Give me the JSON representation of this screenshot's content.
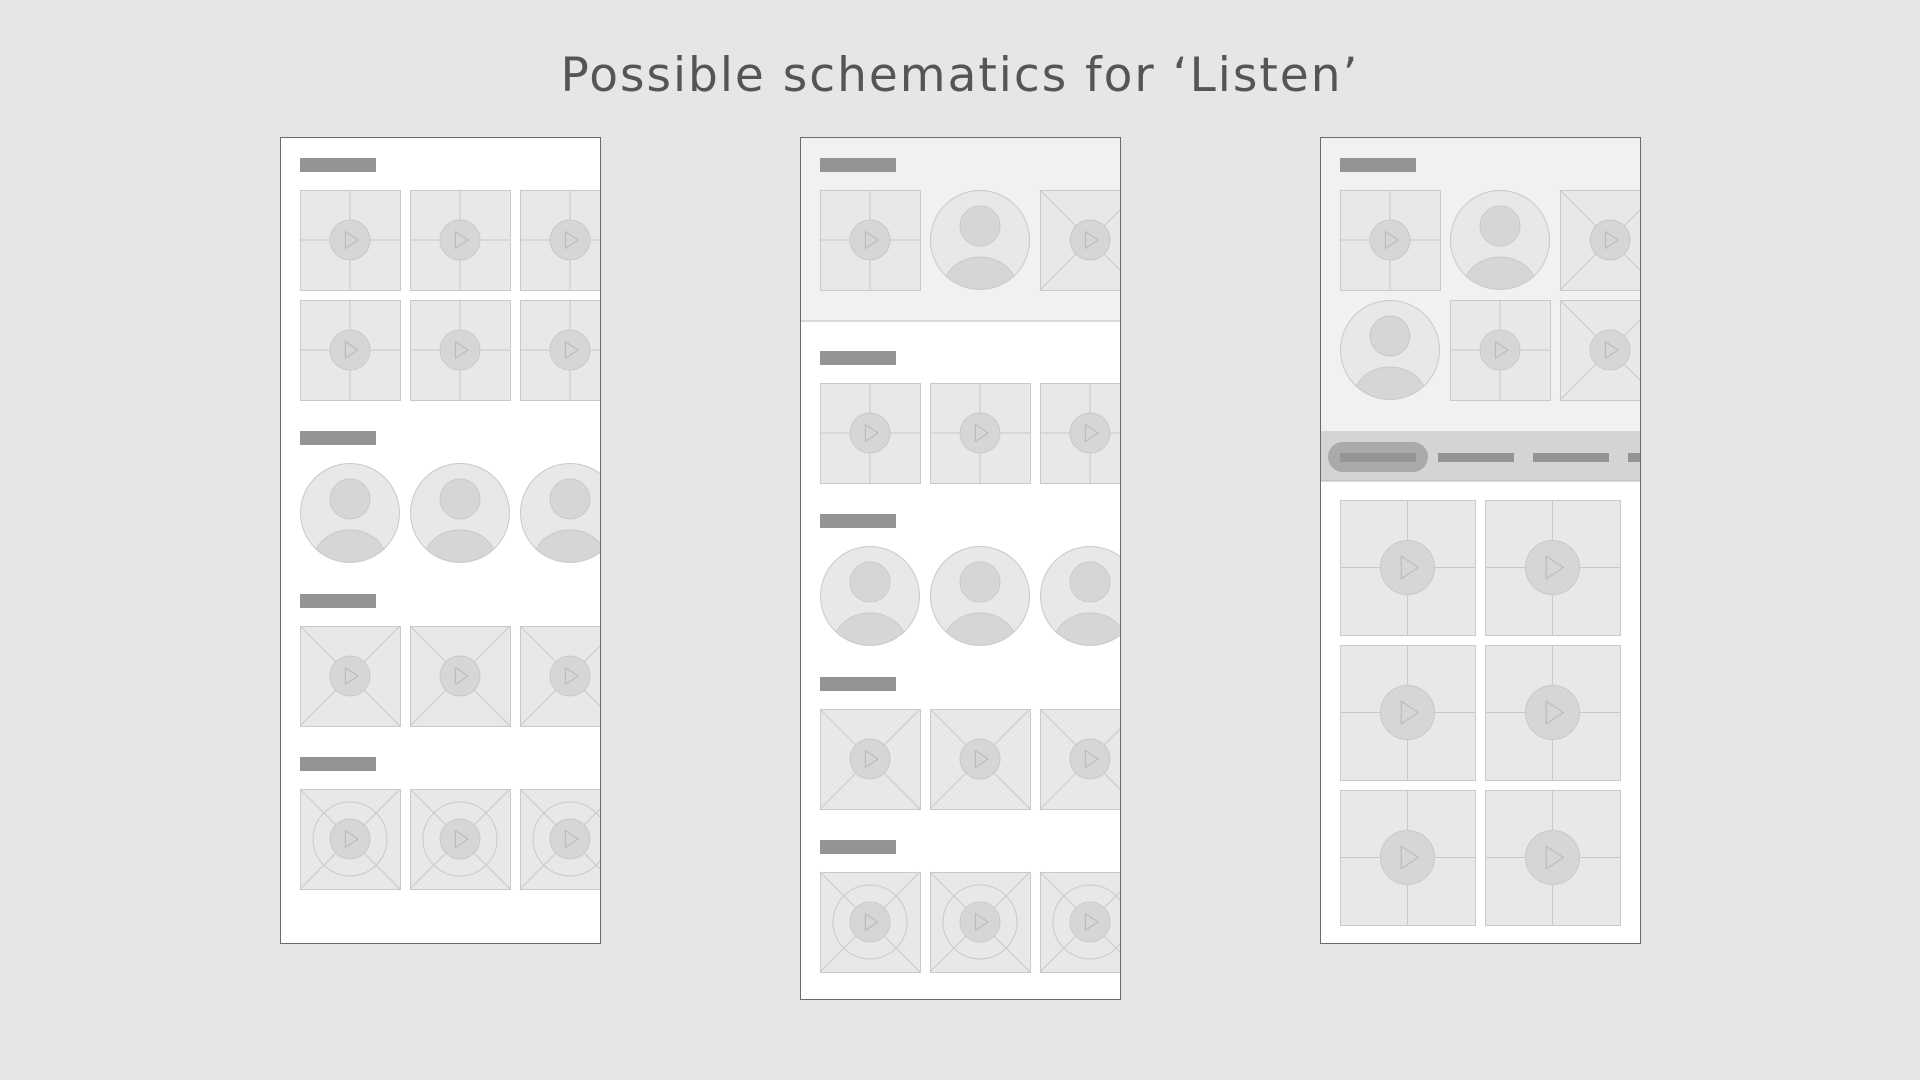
{
  "title": "Possible schematics for ‘Listen’",
  "colors": {
    "background": "#e6e6e6",
    "title_text": "#555555",
    "frame_border": "#6a6a6a",
    "screen_fill": "#ffffff",
    "shaded_section": "#f0f1f0",
    "tab_bar": "#d3d4d5",
    "header_bar": "#939496",
    "tile_fill": "#e8e8e9",
    "tile_stroke": "#c9c9ca",
    "play_fill": "#d6d6d7"
  },
  "schematics": [
    {
      "name": "schematic-1",
      "rows": [
        "grid-tile",
        "grid-tile",
        "avatar",
        "cross-tile",
        "circle-cross-tile"
      ]
    },
    {
      "name": "schematic-2",
      "rows": [
        "mixed-carousel",
        "grid-tile",
        "avatar",
        "cross-tile",
        "circle-cross-tile"
      ]
    },
    {
      "name": "schematic-3",
      "rows": [
        "mixed-grid",
        "tab-bar",
        "large-grid-tiles"
      ]
    }
  ]
}
